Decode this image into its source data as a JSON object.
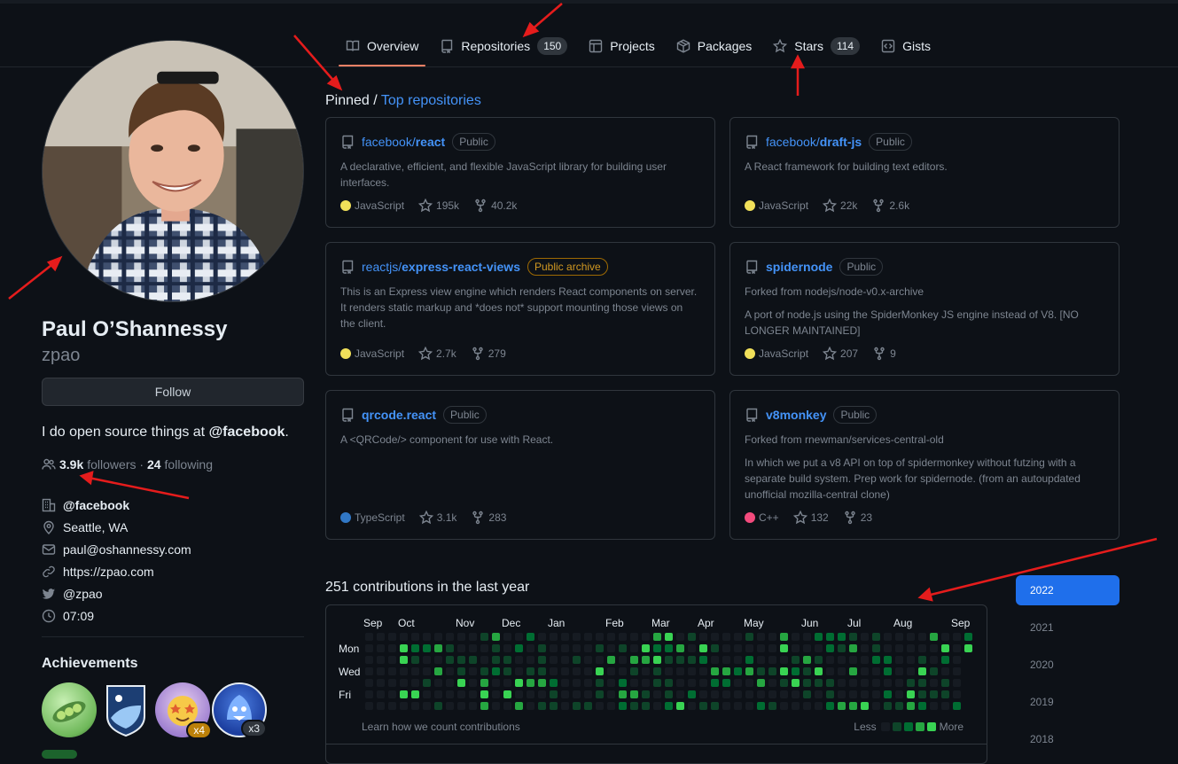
{
  "tabs": [
    {
      "label": "Overview",
      "icon": "book-icon",
      "active": true
    },
    {
      "label": "Repositories",
      "icon": "repo-icon",
      "count": "150"
    },
    {
      "label": "Projects",
      "icon": "table-icon"
    },
    {
      "label": "Packages",
      "icon": "package-icon"
    },
    {
      "label": "Stars",
      "icon": "star-icon",
      "count": "114"
    },
    {
      "label": "Gists",
      "icon": "code-square-icon"
    }
  ],
  "profile": {
    "name": "Paul O’Shannessy",
    "login": "zpao",
    "follow_label": "Follow",
    "bio_prefix": "I do open source things at ",
    "bio_mention": "@facebook",
    "bio_suffix": ".",
    "followers": "3.9k",
    "followers_label": "followers",
    "separator": " · ",
    "following": "24",
    "following_label": "following",
    "details": [
      {
        "icon": "organization-icon",
        "text": "@facebook",
        "bold": true
      },
      {
        "icon": "location-icon",
        "text": "Seattle, WA"
      },
      {
        "icon": "mail-icon",
        "text": "paul@oshannessy.com"
      },
      {
        "icon": "link-icon",
        "text": "https://zpao.com"
      },
      {
        "icon": "twitter-icon",
        "text": "@zpao"
      },
      {
        "icon": "clock-icon",
        "text": "07:09"
      }
    ],
    "achievements_title": "Achievements",
    "achievements": [
      {
        "name": "peas-badge",
        "count": ""
      },
      {
        "name": "shield-badge",
        "count": ""
      },
      {
        "name": "star-struck-badge",
        "count": "x4"
      },
      {
        "name": "shark-badge",
        "count": "x3"
      }
    ]
  },
  "pinned": {
    "label": "Pinned",
    "sep": " / ",
    "link": "Top repositories",
    "repos": [
      {
        "owner": "facebook/",
        "name": "react",
        "visibility": "Public",
        "desc": [
          "A declarative, efficient, and flexible JavaScript library for building user interfaces."
        ],
        "lang": "JavaScript",
        "lang_color": "#f1e05a",
        "stars": "195k",
        "forks": "40.2k"
      },
      {
        "owner": "facebook/",
        "name": "draft-js",
        "visibility": "Public",
        "desc": [
          "A React framework for building text editors."
        ],
        "lang": "JavaScript",
        "lang_color": "#f1e05a",
        "stars": "22k",
        "forks": "2.6k"
      },
      {
        "owner": "reactjs/",
        "name": "express-react-views",
        "visibility": "Public archive",
        "desc": [
          "This is an Express view engine which renders React components on server. It renders static markup and *does not* support mounting those views on the client."
        ],
        "lang": "JavaScript",
        "lang_color": "#f1e05a",
        "stars": "2.7k",
        "forks": "279"
      },
      {
        "owner": "",
        "name": "spidernode",
        "visibility": "Public",
        "desc": [
          "Forked from nodejs/node-v0.x-archive",
          "A port of node.js using the SpiderMonkey JS engine instead of V8. [NO LONGER MAINTAINED]"
        ],
        "lang": "JavaScript",
        "lang_color": "#f1e05a",
        "stars": "207",
        "forks": "9"
      },
      {
        "owner": "",
        "name": "qrcode.react",
        "visibility": "Public",
        "desc": [
          "A <QRCode/> component for use with React."
        ],
        "lang": "TypeScript",
        "lang_color": "#3178c6",
        "stars": "3.1k",
        "forks": "283"
      },
      {
        "owner": "",
        "name": "v8monkey",
        "visibility": "Public",
        "desc": [
          "Forked from rnewman/services-central-old",
          "In which we put a v8 API on top of spidermonkey without futzing with a separate build system. Prep work for spidernode. (from an autoupdated unofficial mozilla-central clone)"
        ],
        "lang": "C++",
        "lang_color": "#f34b7d",
        "stars": "132",
        "forks": "23"
      }
    ]
  },
  "contributions": {
    "title": "251 contributions in the last year",
    "months": [
      "Sep",
      "Oct",
      "Nov",
      "Dec",
      "Jan",
      "Feb",
      "Mar",
      "Apr",
      "May",
      "Jun",
      "Jul",
      "Aug",
      "Sep"
    ],
    "days": [
      "Mon",
      "Wed",
      "Fri"
    ],
    "learn": "Learn how we count contributions",
    "less": "Less",
    "more": "More",
    "colors": [
      "#161b22",
      "#0e4429",
      "#006d32",
      "#26a641",
      "#39d353"
    ]
  },
  "years": [
    "2022",
    "2021",
    "2020",
    "2019",
    "2018"
  ]
}
